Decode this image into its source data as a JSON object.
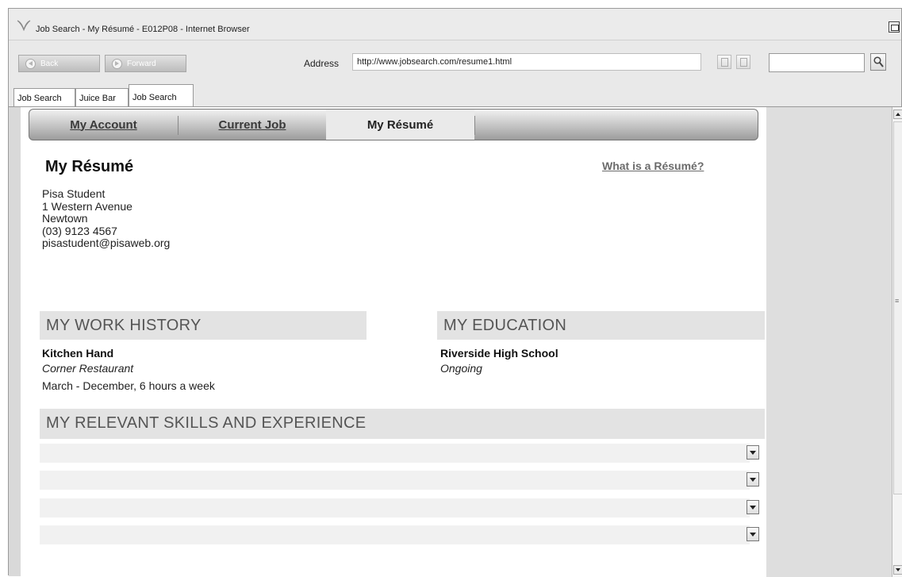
{
  "browser": {
    "title": "Job Search - My Résumé - E012P08 - Internet Browser",
    "back_label": "Back",
    "forward_label": "Forward",
    "address_label": "Address",
    "address_value": "http://www.jobsearch.com/resume1.html",
    "search_value": "",
    "tabs": [
      {
        "label": "Job Search"
      },
      {
        "label": "Juice Bar"
      },
      {
        "label": "Job Search"
      }
    ]
  },
  "site_nav": {
    "items": [
      {
        "label": "My Account"
      },
      {
        "label": "Current Job"
      },
      {
        "label": "My Résumé"
      }
    ],
    "current": "My Résumé"
  },
  "resume": {
    "title": "My Résumé",
    "help_link": "What is a Résumé?",
    "contact": {
      "name": "Pisa Student",
      "address": "1 Western Avenue",
      "suburb": "Newtown",
      "phone": "(03) 9123 4567",
      "email": "pisastudent@pisaweb.org"
    },
    "work_history": {
      "heading": "MY WORK HISTORY",
      "role": "Kitchen Hand",
      "employer": "Corner Restaurant",
      "period": "March - December, 6 hours a week"
    },
    "education": {
      "heading": "MY EDUCATION",
      "school": "Riverside High School",
      "status": "Ongoing"
    },
    "skills": {
      "heading": "MY RELEVANT SKILLS AND EXPERIENCE",
      "rows": [
        "",
        "",
        "",
        ""
      ]
    }
  },
  "colors": {
    "section_background": "#e3e3e3",
    "nav_current": "#eaeaea",
    "link_gray": "#6b6b6b"
  }
}
